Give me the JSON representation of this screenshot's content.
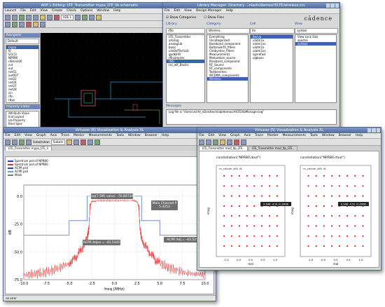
{
  "schematic": {
    "title": "ADE L Editing: LTE_Transmitter mypa_LTE_lib schematic",
    "menu": [
      "Launch",
      "File",
      "Edit",
      "View",
      "Create",
      "Check",
      "Options",
      "Window",
      "Help"
    ],
    "tab": "ADE L",
    "navigator_title": "Navigator",
    "navigator_filter": "Default",
    "tree_items": [
      "mypa",
      "I0",
      "I21(1)",
      "NPRB0",
      "r/Bnrsk00",
      "cut",
      "out",
      "net51",
      "out007",
      "net22",
      "net24",
      "net27",
      "net28",
      "cin",
      "rfin",
      "rbyp",
      "rbiasbut",
      "cmmmf"
    ],
    "property_title": "Property Editor",
    "prop_rows": [
      [
        "Attribute",
        "Value"
      ],
      [
        "Inst",
        "Layout"
      ],
      [
        "Lib",
        "Property"
      ],
      [
        "Bind Spec"
      ]
    ]
  },
  "library": {
    "title": "Library Manager: Directory ...nlazin/demos/rf/LTE/wireless.ccc",
    "menu": [
      "File",
      "Edit",
      "View",
      "Design Manager",
      "Help"
    ],
    "logo": "cādence",
    "show_categories": "Show Categories",
    "show_files": "Show Files",
    "col_library": "Library",
    "col_category": "Category",
    "col_cell": "Cell",
    "col_view": "View",
    "lib_filter": "rflib",
    "cat_filter": "Wireless",
    "cell_filter": "lte",
    "view_filter": "symbol",
    "libraries": [
      "LTE_Transmitter",
      "amslog",
      "analogLib",
      "basic",
      "cdsDefTechLib",
      "gpdk045",
      "rfExamples",
      "rflib",
      "rsc_wlf_Blocks"
    ],
    "categories": [
      "Everything",
      "Uncategorized",
      "Baseband_component",
      "Butterworth_filters",
      "Chebyshev_filters",
      "Measurements",
      "Modulation_source",
      "Passband_component",
      "RF_Source",
      "RF_components",
      "Testbenches",
      "WCDMA_components",
      "Wireless"
    ],
    "cells": [
      "ltecvp",
      "ulatm1x",
      "ulatm1xs",
      "ulatm1x",
      "ulatm1xs",
      "sgnrefast",
      "ulgbase"
    ],
    "view_head": [
      "View",
      "Lock",
      "Size"
    ],
    "views": [
      "spectre",
      "symbol"
    ],
    "messages_title": "Messages",
    "message_text": "Log file is \"/lam/cvs/rfe_nDisk/tech/lab/demos/rf/LTE/libManager.log\""
  },
  "viva_main": {
    "title": "Virtuoso (R) Visualization & Analysis XL",
    "menu": [
      "File",
      "Edit",
      "View",
      "Graph",
      "Axis",
      "Trace",
      "Marker",
      "Measurements",
      "Tools",
      "Window",
      "Browser",
      "Help"
    ],
    "subwindow_label": "Subwindow:",
    "subwindow_value": "Subwin",
    "tabs": [
      "LTE_Transmitter mypa_LTE_li"
    ],
    "legend_title": "Spectrum psd of NPRB0",
    "legend_items": [
      {
        "label": "Spectrum psd of NPRB0",
        "color": "#2a3bd8"
      },
      {
        "label": "Spectrum psd of NPRB0",
        "color": "#e63030"
      },
      {
        "label": "ACPR psd",
        "color": "#2a3bd8"
      },
      {
        "label": "ACPR psd",
        "color": "#5aa0e0"
      },
      {
        "label": "Mask",
        "color": "#7a7a7a"
      }
    ],
    "status_text": "no error",
    "annotations": {
      "freq": "freq(7.5M) value: -76.847340",
      "main": "Main Channel P\n5.4253",
      "acpr_left": "ACPR Adjes = -43.5345",
      "acpr_right": "ACPR Adj = -43.5251"
    }
  },
  "chart_data": {
    "type": "line",
    "title": "",
    "xlabel": "freq (MHz)",
    "ylabel": "dB",
    "xlim": [
      -10.0,
      10.0
    ],
    "ylim": [
      -75.0,
      10.0
    ],
    "x_ticks": [
      "-10.0",
      "-7.5",
      "-5.0",
      "-2.5",
      "0.0",
      "2.5",
      "5.0",
      "7.5",
      "10.0"
    ],
    "y_ticks": [
      "0.0",
      "-25.0",
      "-50.0",
      "-75.0"
    ],
    "series": [
      {
        "name": "Spectrum psd of NPRB0",
        "color": "#e63030",
        "x": [
          -10,
          -9,
          -8,
          -7,
          -6,
          -5,
          -4.5,
          -4,
          -3.5,
          -3,
          -2.8,
          -2.7,
          -2.5,
          -2,
          -1,
          0,
          1,
          2,
          2.5,
          2.7,
          2.8,
          3,
          3.5,
          4,
          4.5,
          5,
          6,
          7,
          8,
          9,
          10
        ],
        "y": [
          -71,
          -70,
          -69,
          -67,
          -64,
          -60,
          -57,
          -52,
          -46,
          -38,
          -28,
          -10,
          -5,
          -4,
          -4,
          -4,
          -4,
          -4,
          -5,
          -10,
          -28,
          -38,
          -46,
          -52,
          -57,
          -60,
          -64,
          -67,
          -69,
          -70,
          -71
        ]
      },
      {
        "name": "Mask",
        "color": "#5a78c8",
        "x": [
          -10,
          -5,
          -5,
          -3,
          -3,
          3,
          3,
          5,
          5,
          10
        ],
        "y": [
          -35,
          -35,
          -22,
          -22,
          0,
          0,
          -22,
          -22,
          -35,
          -35
        ]
      }
    ]
  },
  "viva_const": {
    "title": "Virtuoso (R) Visualization & Analysis XL",
    "menu": [
      "File",
      "Edit",
      "View",
      "Graph",
      "Axis",
      "Trace",
      "Marker",
      "Measurements",
      "Tools",
      "Window",
      "Browser",
      "Help"
    ],
    "tabs": [
      "LTE_Transmitter mod_ltp_LTE..",
      "LTE_Transmitter mod_ltp_LTE.."
    ],
    "plot_left_title": "constellation(\"NPRB0.dout\")",
    "plot_right_title": "constellation(\"NPRB0.rfout\")",
    "legend": "re_cdiode (dB) W",
    "marker_label": "0.948 -4.91 m.000B",
    "xlabel": "real",
    "ylabel": "imag"
  },
  "constellation": {
    "type": "scatter",
    "x": [
      -1.08,
      -0.77,
      -0.46,
      -0.15,
      0.15,
      0.46,
      0.77,
      1.08
    ],
    "y": [
      -1.08,
      -0.77,
      -0.46,
      -0.15,
      0.15,
      0.46,
      0.77,
      1.08
    ],
    "xlim": [
      -1.4,
      1.4
    ],
    "ylim": [
      -1.4,
      1.4
    ],
    "x_ticks": [
      "-1.5",
      "-1.0",
      "-0.5",
      "0.0",
      "0.5",
      "1.0",
      "1.5"
    ]
  }
}
